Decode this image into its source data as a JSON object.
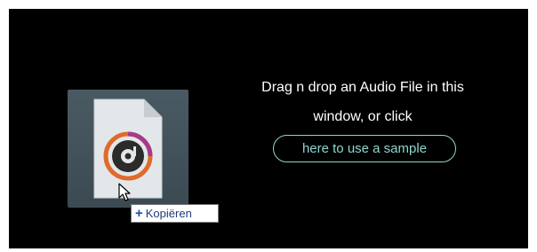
{
  "drop_zone": {
    "line1": "Drag n drop an Audio File in this",
    "line2": "window, or click",
    "sample_button": "here to use a sample"
  },
  "drag_tooltip": {
    "icon": "plus-icon",
    "label": "Kopiëren"
  },
  "icons": {
    "file": "audio-file-icon",
    "cursor": "arrow-cursor-icon"
  },
  "colors": {
    "panel_bg": "#000000",
    "accent": "#8fd6cf",
    "tile_bg": "#4a5a63"
  }
}
